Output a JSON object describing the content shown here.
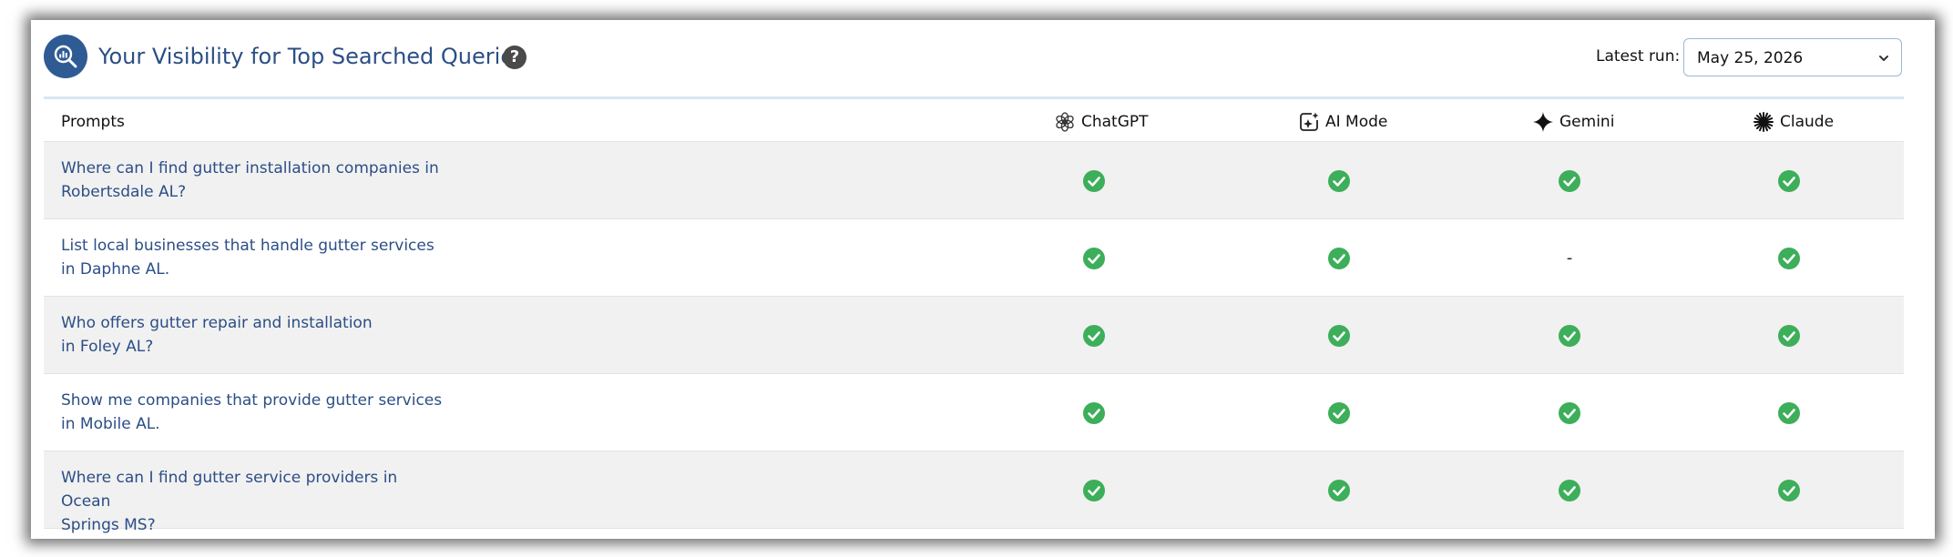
{
  "header": {
    "title": "Your Visibility for Top Searched Queries",
    "help": "?",
    "latest_run_label": "Latest run:",
    "latest_run_value": "May 25, 2026"
  },
  "table": {
    "prompts_header": "Prompts",
    "columns": [
      {
        "label": "ChatGPT",
        "icon": "chatgpt-icon"
      },
      {
        "label": "AI Mode",
        "icon": "ai-mode-icon"
      },
      {
        "label": "Gemini",
        "icon": "gemini-icon"
      },
      {
        "label": "Claude",
        "icon": "claude-icon"
      }
    ],
    "rows": [
      {
        "prompt": "Where can I find gutter installation companies in\nRobertsdale AL?",
        "status": [
          "check",
          "check",
          "check",
          "check"
        ]
      },
      {
        "prompt": "List local businesses that handle gutter services\nin Daphne AL.",
        "status": [
          "check",
          "check",
          "-",
          "check"
        ]
      },
      {
        "prompt": "Who offers gutter repair and installation\nin Foley AL?",
        "status": [
          "check",
          "check",
          "check",
          "check"
        ]
      },
      {
        "prompt": "Show me companies that provide gutter services\nin Mobile AL.",
        "status": [
          "check",
          "check",
          "check",
          "check"
        ]
      },
      {
        "prompt": "Where can I find gutter service providers in Ocean\nSprings MS?",
        "status": [
          "check",
          "check",
          "check",
          "check"
        ]
      }
    ]
  },
  "colors": {
    "brand": "#2f5b94",
    "title": "#2b4e86",
    "check": "#3dae5a",
    "row_alt": "#f1f1f1"
  }
}
